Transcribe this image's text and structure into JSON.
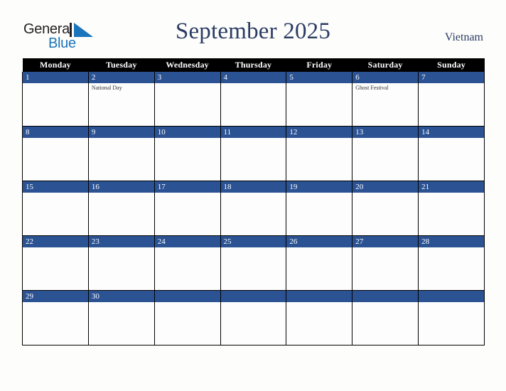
{
  "brand": {
    "name_part1": "General",
    "name_part2": "Blue",
    "triangle_icon": "blue-triangle-icon",
    "colors": {
      "dark": "#231f20",
      "blue": "#1b75bc"
    }
  },
  "header": {
    "title": "September 2025",
    "country": "Vietnam",
    "title_color": "#2b3c63"
  },
  "calendar": {
    "header_background": "#000000",
    "date_bar_color": "#2b5394",
    "cell_background": "#fdfdfd",
    "weekday_headers": [
      "Monday",
      "Tuesday",
      "Wednesday",
      "Thursday",
      "Friday",
      "Saturday",
      "Sunday"
    ],
    "weeks": [
      [
        {
          "day": "1",
          "events": []
        },
        {
          "day": "2",
          "events": [
            "National Day"
          ]
        },
        {
          "day": "3",
          "events": []
        },
        {
          "day": "4",
          "events": []
        },
        {
          "day": "5",
          "events": []
        },
        {
          "day": "6",
          "events": [
            "Ghost Festival"
          ]
        },
        {
          "day": "7",
          "events": []
        }
      ],
      [
        {
          "day": "8",
          "events": []
        },
        {
          "day": "9",
          "events": []
        },
        {
          "day": "10",
          "events": []
        },
        {
          "day": "11",
          "events": []
        },
        {
          "day": "12",
          "events": []
        },
        {
          "day": "13",
          "events": []
        },
        {
          "day": "14",
          "events": []
        }
      ],
      [
        {
          "day": "15",
          "events": []
        },
        {
          "day": "16",
          "events": []
        },
        {
          "day": "17",
          "events": []
        },
        {
          "day": "18",
          "events": []
        },
        {
          "day": "19",
          "events": []
        },
        {
          "day": "20",
          "events": []
        },
        {
          "day": "21",
          "events": []
        }
      ],
      [
        {
          "day": "22",
          "events": []
        },
        {
          "day": "23",
          "events": []
        },
        {
          "day": "24",
          "events": []
        },
        {
          "day": "25",
          "events": []
        },
        {
          "day": "26",
          "events": []
        },
        {
          "day": "27",
          "events": []
        },
        {
          "day": "28",
          "events": []
        }
      ],
      [
        {
          "day": "29",
          "events": []
        },
        {
          "day": "30",
          "events": []
        },
        {
          "day": "",
          "events": []
        },
        {
          "day": "",
          "events": []
        },
        {
          "day": "",
          "events": []
        },
        {
          "day": "",
          "events": []
        },
        {
          "day": "",
          "events": []
        }
      ]
    ]
  }
}
